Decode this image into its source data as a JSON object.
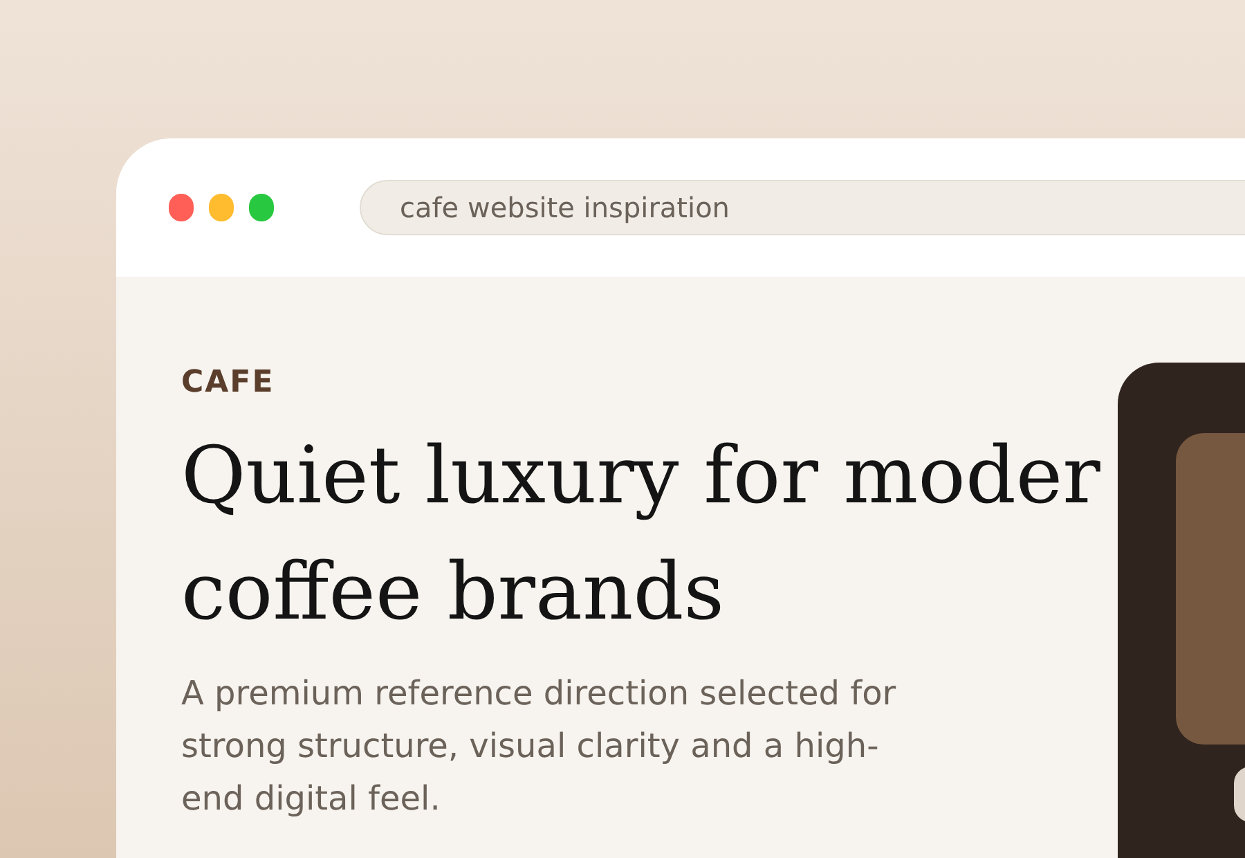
{
  "browser": {
    "address": "cafe website inspiration"
  },
  "hero": {
    "eyebrow": "CAFE",
    "heading_lines": [
      "Quiet luxury for moder",
      "coffee brands"
    ],
    "description_lines": [
      "A premium reference direction selected for",
      "strong structure, visual clarity and a high-",
      "end digital feel."
    ]
  }
}
